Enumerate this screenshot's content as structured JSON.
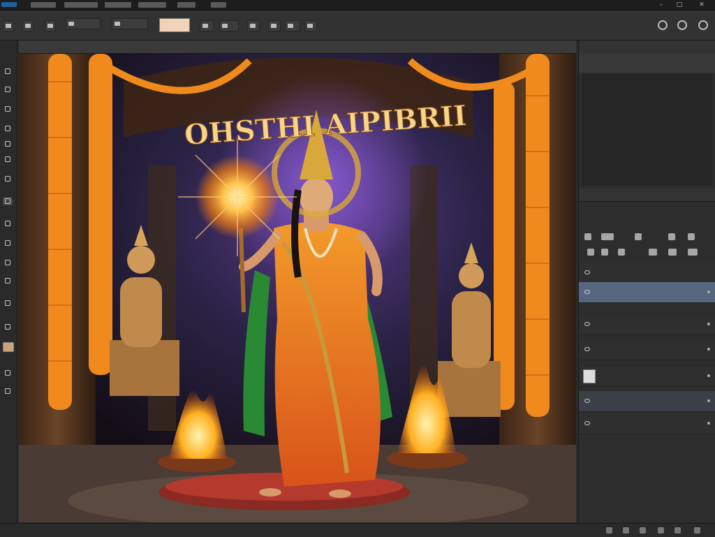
{
  "app": {
    "title": ""
  },
  "document": {
    "tab_label": ""
  },
  "artwork": {
    "title_text": "OHSTHI AIPIBRII"
  },
  "panels": {
    "top_tabs": [
      "",
      ""
    ],
    "properties": {
      "row_label": "",
      "row_value": ""
    },
    "layers_tabs": [
      "",
      ""
    ],
    "layers_panel_title": ""
  },
  "layers": [
    {
      "name": "",
      "selected": false,
      "thumb": false
    },
    {
      "name": "",
      "selected": true,
      "thumb": false
    },
    {
      "name": "",
      "selected": false,
      "thumb": false
    },
    {
      "name": "",
      "selected": false,
      "thumb": false
    },
    {
      "name": "",
      "selected": false,
      "thumb": true
    },
    {
      "name": "",
      "selected": false,
      "thumb": false,
      "hilite": true
    },
    {
      "name": "",
      "selected": false,
      "thumb": false
    }
  ],
  "status": {
    "text": ""
  },
  "colors": {
    "accent_selected_layer": "#58677f",
    "foreground_swatch": "#f1d3b8",
    "canvas_marigold": "#f08a1c",
    "canvas_saree": "#e8761a",
    "canvas_sash": "#2a8a34"
  }
}
